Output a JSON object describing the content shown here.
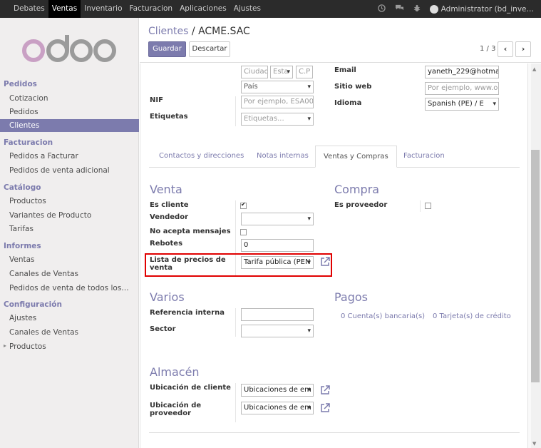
{
  "topbar": {
    "menu": [
      "Debates",
      "Ventas",
      "Inventario",
      "Facturacion",
      "Aplicaciones",
      "Ajustes"
    ],
    "user": "Administrator (bd_inve…"
  },
  "sidebar": {
    "sections": [
      {
        "title": "Pedidos",
        "items": [
          "Cotizacion",
          "Pedidos",
          "Clientes"
        ]
      },
      {
        "title": "Facturacion",
        "items": [
          "Pedidos a Facturar",
          "Pedidos de venta adicional"
        ]
      },
      {
        "title": "Catálogo",
        "items": [
          "Productos",
          "Variantes de Producto",
          "Tarifas"
        ]
      },
      {
        "title": "Informes",
        "items": [
          "Ventas",
          "Canales de Ventas",
          "Pedidos de venta de todos los…"
        ]
      },
      {
        "title": "Configuración",
        "items": [
          "Ajustes",
          "Canales de Ventas",
          "Productos"
        ]
      }
    ],
    "active_item": "Clientes",
    "expand_arrow": "▸"
  },
  "breadcrumb": {
    "parent": "Clientes",
    "separator": "/",
    "current": "ACME.SAC"
  },
  "buttons": {
    "save": "Guardar",
    "discard": "Descartar"
  },
  "pager": {
    "text": "1 / 3",
    "prev": "‹",
    "next": "›"
  },
  "address": {
    "city_ph": "Ciudad",
    "state_ph": "Esta",
    "zip_ph": "C.P",
    "country_ph": "País"
  },
  "fields_left": {
    "nif_label": "NIF",
    "nif_ph": "Por ejemplo, ESA00",
    "tags_label": "Etiquetas",
    "tags_ph": "Etiquetas..."
  },
  "fields_right": {
    "email_label": "Email",
    "email_value": "yaneth_229@hotma",
    "web_label": "Sitio web",
    "web_ph": "Por ejemplo, www.oc",
    "lang_label": "Idioma",
    "lang_value": "Spanish (PE) / E"
  },
  "tabs": [
    "Contactos y direcciones",
    "Notas internas",
    "Ventas y Compras",
    "Facturacion"
  ],
  "active_tab": "Ventas y Compras",
  "venta": {
    "title": "Venta",
    "customer_label": "Es cliente",
    "customer_checked": true,
    "seller_label": "Vendedor",
    "no_msg_label": "No acepta mensajes",
    "no_msg_checked": false,
    "bounce_label": "Rebotes",
    "bounce_value": "0",
    "pricelist_label_1": "Lista de precios de",
    "pricelist_label_2": "venta",
    "pricelist_value": "Tarifa pública (PEN"
  },
  "compra": {
    "title": "Compra",
    "supplier_label": "Es proveedor",
    "supplier_checked": false
  },
  "varios": {
    "title": "Varios",
    "ref_label": "Referencia interna",
    "sector_label": "Sector"
  },
  "pagos": {
    "title": "Pagos",
    "bank": "0 Cuenta(s) bancaria(s)",
    "cards": "0 Tarjeta(s) de crédito"
  },
  "almacen": {
    "title": "Almacén",
    "cust_loc_label": "Ubicación de cliente",
    "cust_loc_value": "Ubicaciones de em",
    "supp_loc_label_1": "Ubicación de",
    "supp_loc_label_2": "proveedor",
    "supp_loc_value": "Ubicaciones de em"
  },
  "colors": {
    "brand": "#7c7bad",
    "highlight": "#e00000",
    "topbar": "#2b2b2b"
  }
}
